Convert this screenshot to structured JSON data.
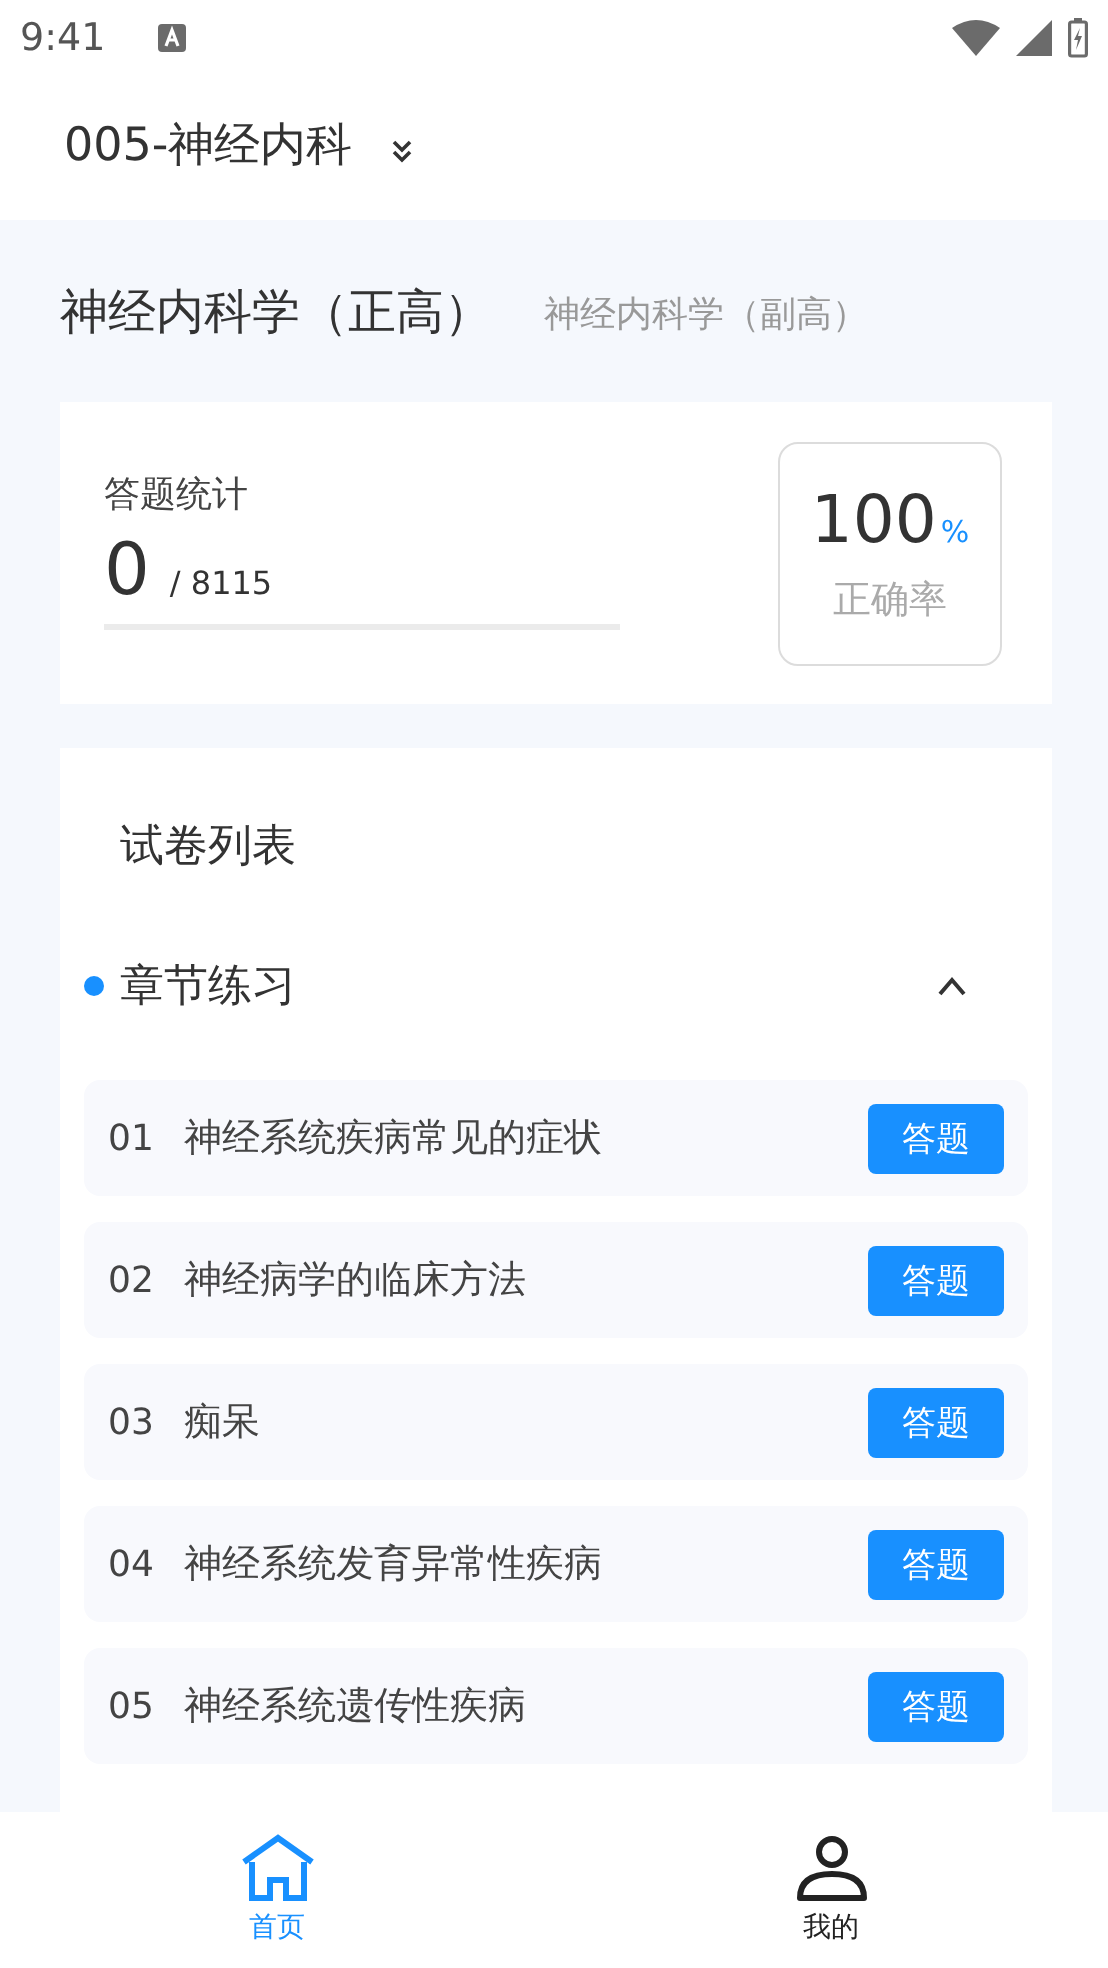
{
  "status_bar": {
    "time": "9:41"
  },
  "header": {
    "title": "005-神经内科"
  },
  "tabs": [
    {
      "label": "神经内科学（正高）",
      "selected": true
    },
    {
      "label": "神经内科学（副高）",
      "selected": false
    }
  ],
  "stats": {
    "label": "答题统计",
    "answered": "0",
    "total": "/ 8115",
    "level": 0,
    "accuracy": "100",
    "accuracy_unit": "%",
    "accuracy_label": "正确率"
  },
  "paper_list": {
    "title": "试卷列表",
    "section": {
      "title": "章节练习",
      "expanded": true,
      "items": [
        {
          "number": "01",
          "title": "神经系统疾病常见的症状",
          "action": "答题"
        },
        {
          "number": "02",
          "title": "神经病学的临床方法",
          "action": "答题"
        },
        {
          "number": "03",
          "title": "痴呆",
          "action": "答题"
        },
        {
          "number": "04",
          "title": "神经系统发育异常性疾病",
          "action": "答题"
        },
        {
          "number": "05",
          "title": "神经系统遗传性疾病",
          "action": "答题"
        }
      ]
    }
  },
  "bottom_nav": [
    {
      "label": "首页",
      "kind": "home",
      "selected": true
    },
    {
      "label": "我的",
      "kind": "profile",
      "selected": false
    }
  ]
}
